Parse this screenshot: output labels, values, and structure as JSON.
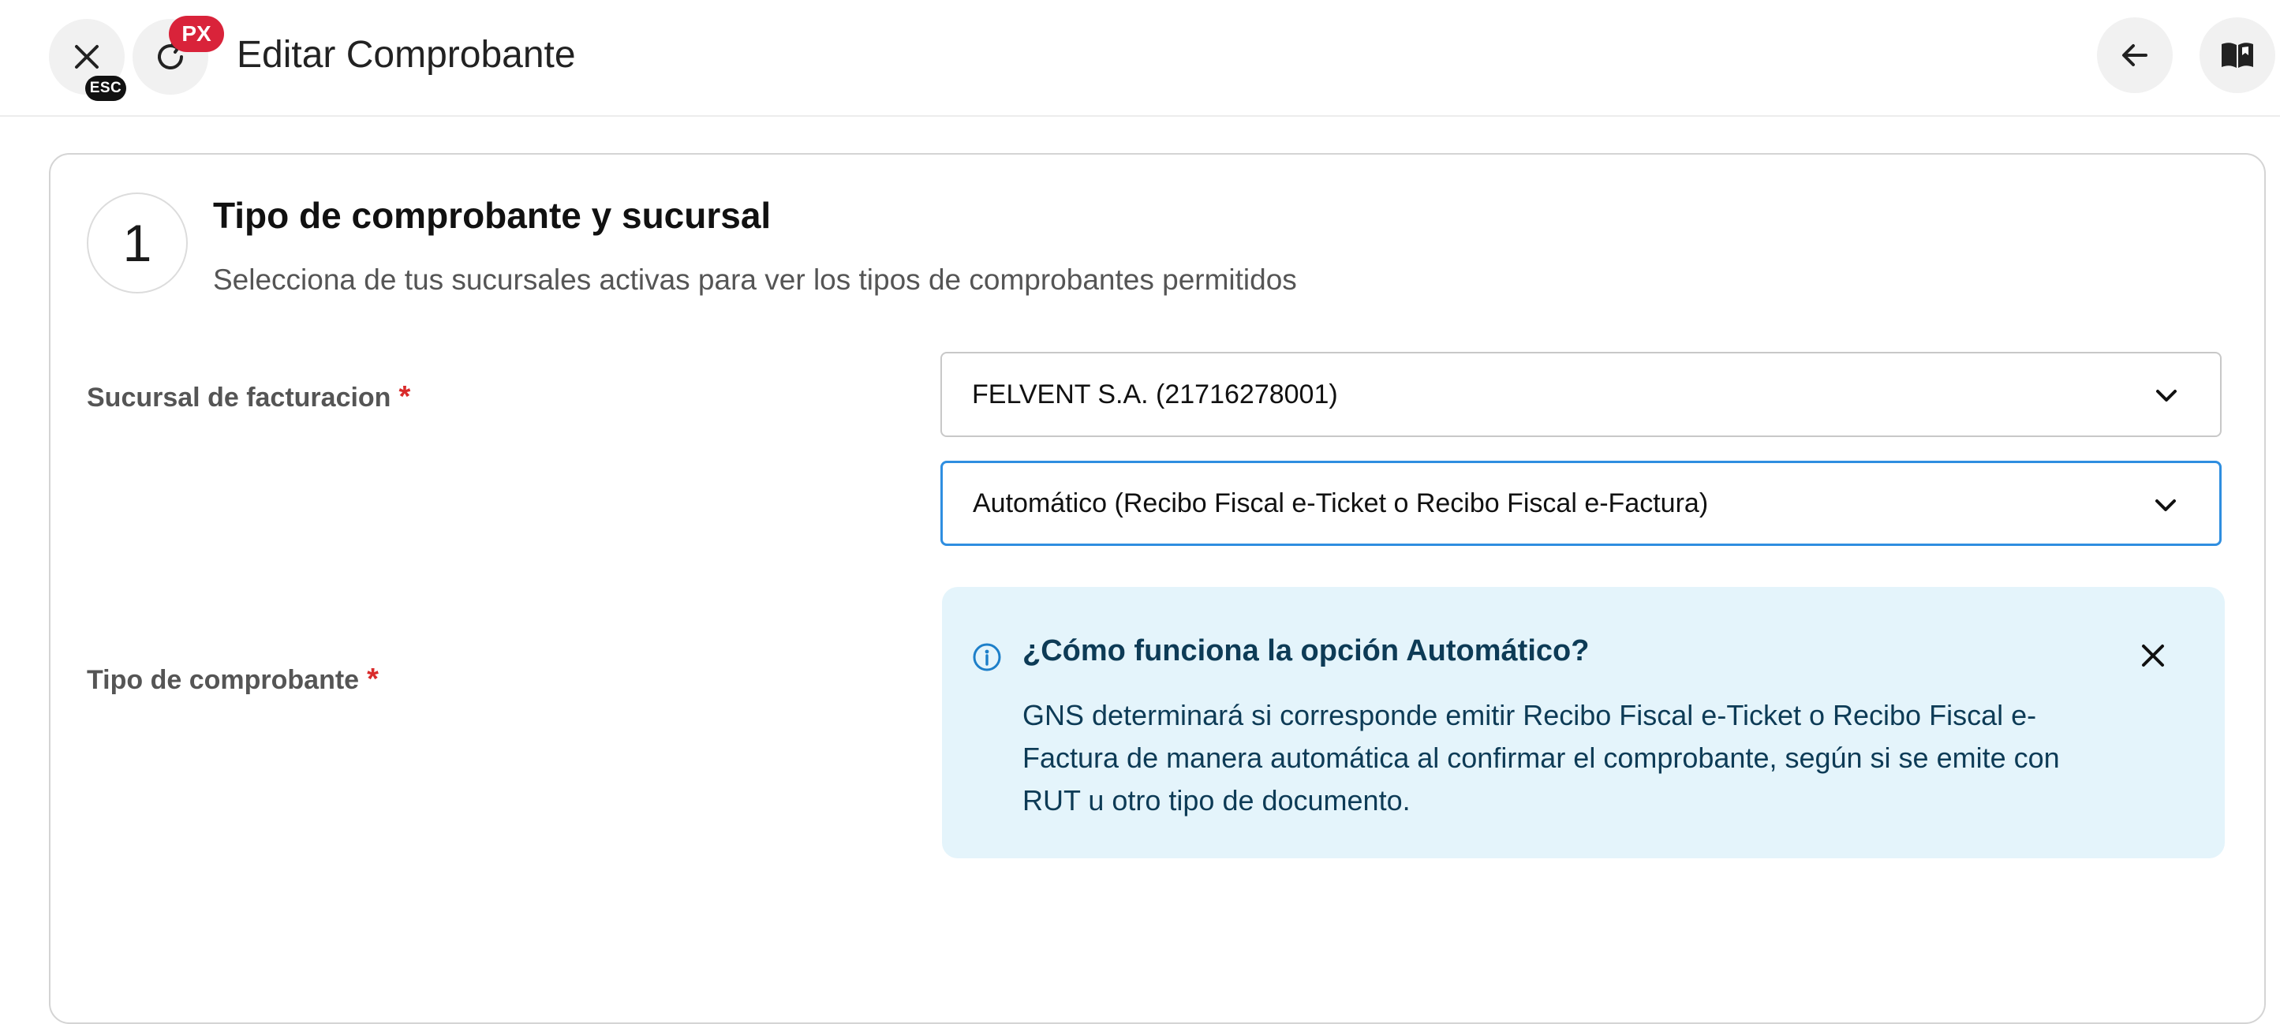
{
  "header": {
    "close_badge": "ESC",
    "refresh_badge": "PX",
    "title": "Editar Comprobante"
  },
  "step": {
    "number": "1",
    "title": "Tipo de comprobante y sucursal",
    "subtitle": "Selecciona de tus sucursales activas para ver los tipos de comprobantes permitidos"
  },
  "form": {
    "sucursal_label": "Sucursal de facturacion",
    "sucursal_value": "FELVENT S.A. (21716278001)",
    "tipo_label": "Tipo de comprobante",
    "tipo_value": "Automático (Recibo Fiscal e-Ticket o Recibo Fiscal e-Factura)",
    "required_mark": "*"
  },
  "info": {
    "title": "¿Cómo funciona la opción Automático?",
    "text": "GNS determinará si corresponde emitir Recibo Fiscal e-Ticket o Recibo Fiscal e-Factura de manera automática al confirmar el comprobante, según si se emite con RUT u otro tipo de documento."
  },
  "colors": {
    "accent": "#2f8ee0",
    "required": "#d92b2b",
    "badge_red": "#d9233a",
    "info_bg": "#e4f4fb",
    "info_text": "#0d3b56"
  },
  "icons": {
    "close": "close-icon",
    "refresh": "refresh-icon",
    "back": "arrow-left-icon",
    "docs": "book-icon",
    "dropdown": "chevron-down-icon",
    "info": "info-icon"
  }
}
